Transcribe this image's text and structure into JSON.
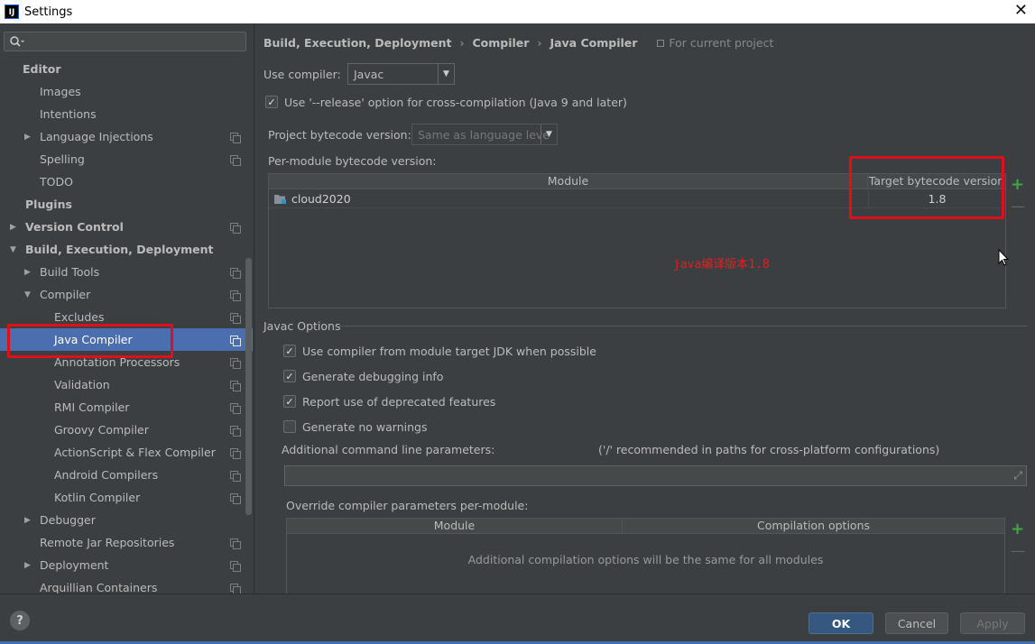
{
  "window": {
    "title": "Settings",
    "app_icon_text": "IJ"
  },
  "sidebar": {
    "search_placeholder": "",
    "items": [
      {
        "label": "Editor",
        "level": 0,
        "bold": true,
        "arrow": "",
        "project": false
      },
      {
        "label": "Images",
        "level": 1,
        "bold": false,
        "arrow": "",
        "project": false
      },
      {
        "label": "Intentions",
        "level": 1,
        "bold": false,
        "arrow": "",
        "project": false
      },
      {
        "label": "Language Injections",
        "level": 1,
        "bold": false,
        "arrow": "right",
        "project": true
      },
      {
        "label": "Spelling",
        "level": 1,
        "bold": false,
        "arrow": "",
        "project": true
      },
      {
        "label": "TODO",
        "level": 1,
        "bold": false,
        "arrow": "",
        "project": false
      },
      {
        "label": "Plugins",
        "level": 0,
        "bold": true,
        "arrow": "",
        "project": false
      },
      {
        "label": "Version Control",
        "level": 0,
        "bold": true,
        "arrow": "right",
        "project": true
      },
      {
        "label": "Build, Execution, Deployment",
        "level": 0,
        "bold": true,
        "arrow": "down",
        "project": false
      },
      {
        "label": "Build Tools",
        "level": 1,
        "bold": false,
        "arrow": "right",
        "project": true
      },
      {
        "label": "Compiler",
        "level": 1,
        "bold": false,
        "arrow": "down",
        "project": true
      },
      {
        "label": "Excludes",
        "level": 2,
        "bold": false,
        "arrow": "",
        "project": true
      },
      {
        "label": "Java Compiler",
        "level": 2,
        "bold": false,
        "arrow": "",
        "project": true,
        "selected": true
      },
      {
        "label": "Annotation Processors",
        "level": 2,
        "bold": false,
        "arrow": "",
        "project": true
      },
      {
        "label": "Validation",
        "level": 2,
        "bold": false,
        "arrow": "",
        "project": true
      },
      {
        "label": "RMI Compiler",
        "level": 2,
        "bold": false,
        "arrow": "",
        "project": true
      },
      {
        "label": "Groovy Compiler",
        "level": 2,
        "bold": false,
        "arrow": "",
        "project": true
      },
      {
        "label": "ActionScript & Flex Compiler",
        "level": 2,
        "bold": false,
        "arrow": "",
        "project": true
      },
      {
        "label": "Android Compilers",
        "level": 2,
        "bold": false,
        "arrow": "",
        "project": true
      },
      {
        "label": "Kotlin Compiler",
        "level": 2,
        "bold": false,
        "arrow": "",
        "project": true
      },
      {
        "label": "Debugger",
        "level": 1,
        "bold": false,
        "arrow": "right",
        "project": false
      },
      {
        "label": "Remote Jar Repositories",
        "level": 1,
        "bold": false,
        "arrow": "",
        "project": true
      },
      {
        "label": "Deployment",
        "level": 1,
        "bold": false,
        "arrow": "right",
        "project": true
      },
      {
        "label": "Arquillian Containers",
        "level": 1,
        "bold": false,
        "arrow": "",
        "project": true
      }
    ]
  },
  "breadcrumb": {
    "parts": [
      "Build, Execution, Deployment",
      "Compiler",
      "Java Compiler"
    ],
    "sep": "›",
    "for_current_project": "For current project"
  },
  "compiler": {
    "use_compiler_label": "Use compiler:",
    "use_compiler_value": "Javac",
    "release_option_label": "Use '--release' option for cross-compilation (Java 9 and later)",
    "release_option_checked": true,
    "project_bytecode_label": "Project bytecode version:",
    "project_bytecode_value": "Same as language leve",
    "per_module_label": "Per-module bytecode version:",
    "module_table": {
      "columns": [
        "Module",
        "Target bytecode version"
      ],
      "rows": [
        {
          "module": "cloud2020",
          "version": "1.8"
        }
      ]
    },
    "annotation_text": "java编译版本1.8"
  },
  "javac_options": {
    "section_title": "Javac Options",
    "checkboxes": [
      {
        "label": "Use compiler from module target JDK when possible",
        "checked": true
      },
      {
        "label": "Generate debugging info",
        "checked": true
      },
      {
        "label": "Report use of deprecated features",
        "checked": true
      },
      {
        "label": "Generate no warnings",
        "checked": false
      }
    ],
    "additional_params_label": "Additional command line parameters:",
    "additional_params_hint": "('/' recommended in paths for cross-platform configurations)",
    "additional_params_value": "",
    "override_label": "Override compiler parameters per-module:",
    "override_table": {
      "columns": [
        "Module",
        "Compilation options"
      ],
      "empty_text": "Additional compilation options will be the same for all modules"
    }
  },
  "buttons": {
    "ok": "OK",
    "cancel": "Cancel",
    "apply": "Apply",
    "help": "?"
  },
  "icons": {
    "plus": "+",
    "minus": "—",
    "checkmark": "✓",
    "dropdown": "▼",
    "arrow_right": "▶",
    "arrow_down": "▼",
    "close": "✕",
    "expand": "⤢"
  },
  "colors": {
    "selection": "#4b6eaf",
    "highlight_red": "#e00f1a",
    "plus_green": "#3ea83e",
    "primary_button": "#365880"
  }
}
